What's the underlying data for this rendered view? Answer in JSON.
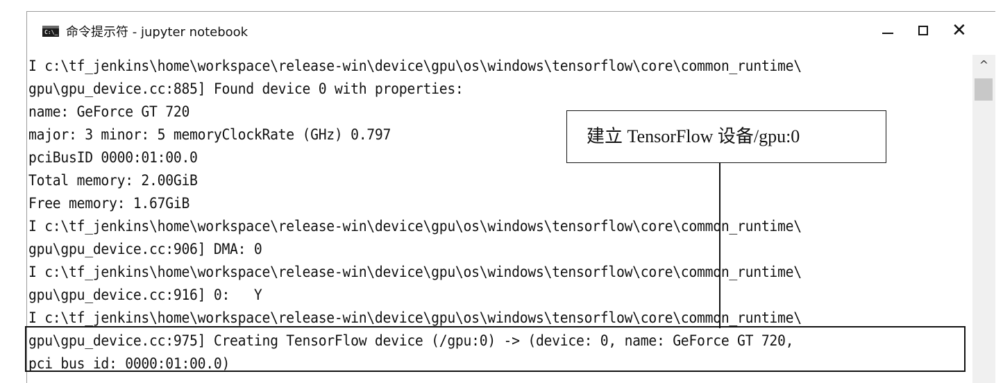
{
  "window": {
    "title": "命令提示符 - jupyter notebook",
    "icon": "cmd-console-icon",
    "controls": {
      "minimize": "—",
      "maximize": "□",
      "close": "✕"
    }
  },
  "console": {
    "lines": [
      "I c:\\tf_jenkins\\home\\workspace\\release-win\\device\\gpu\\os\\windows\\tensorflow\\core\\common_runtime\\",
      "gpu\\gpu_device.cc:885] Found device 0 with properties:",
      "name: GeForce GT 720",
      "major: 3 minor: 5 memoryClockRate (GHz) 0.797",
      "pciBusID 0000:01:00.0",
      "Total memory: 2.00GiB",
      "Free memory: 1.67GiB",
      "I c:\\tf_jenkins\\home\\workspace\\release-win\\device\\gpu\\os\\windows\\tensorflow\\core\\common_runtime\\",
      "gpu\\gpu_device.cc:906] DMA: 0",
      "I c:\\tf_jenkins\\home\\workspace\\release-win\\device\\gpu\\os\\windows\\tensorflow\\core\\common_runtime\\",
      "gpu\\gpu_device.cc:916] 0:   Y",
      "I c:\\tf_jenkins\\home\\workspace\\release-win\\device\\gpu\\os\\windows\\tensorflow\\core\\common_runtime\\",
      "gpu\\gpu_device.cc:975] Creating TensorFlow device (/gpu:0) -> (device: 0, name: GeForce GT 720,",
      "pci bus id: 0000:01:00.0)"
    ]
  },
  "scrollbar": {
    "up_arrow": "^"
  },
  "annotation": {
    "callout_text": "建立 TensorFlow 设备/gpu:0"
  }
}
